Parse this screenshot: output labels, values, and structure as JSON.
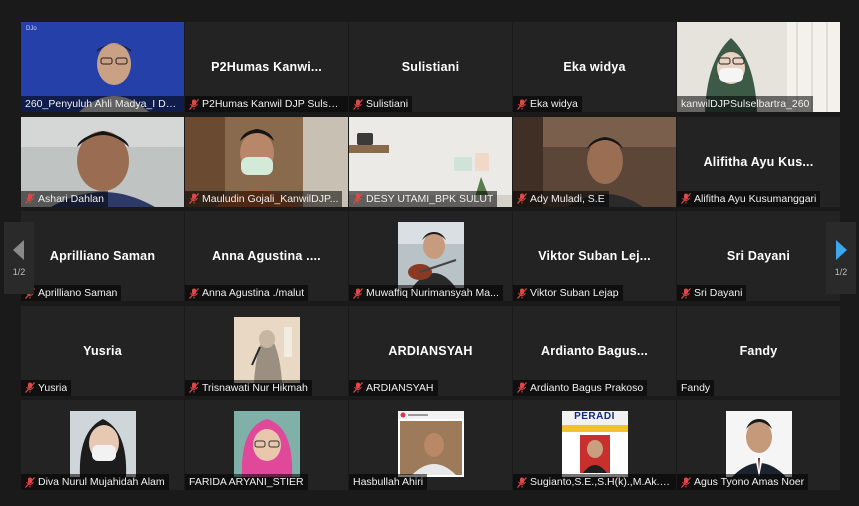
{
  "pager": {
    "left_page": "1/2",
    "right_page": "1/2"
  },
  "colors": {
    "active_speaker_border": "#c8d46a",
    "mic_off": "#e04848",
    "next_arrow": "#3ba7ef"
  },
  "tiles": [
    {
      "center": "",
      "label": "260_Penyuluh Ahli Madya_I De...",
      "muted": false,
      "video": "speaker-video",
      "watermark": "DJo"
    },
    {
      "center": "P2Humas  Kanwi...",
      "label": "P2Humas Kanwil DJP Sulsel...",
      "muted": true
    },
    {
      "center": "Sulistiani",
      "label": "Sulistiani",
      "muted": true
    },
    {
      "center": "Eka widya",
      "label": "Eka widya",
      "muted": true
    },
    {
      "center": "",
      "label": "kanwilDJPSulselbartra_260",
      "muted": false,
      "video": "hijab-mask-video"
    },
    {
      "center": "",
      "label": "Ashari Dahlan",
      "muted": true,
      "video": "man-video"
    },
    {
      "center": "",
      "label": "Mauludin Gojali_KanwilDJP...",
      "muted": true,
      "video": "mask-man-video"
    },
    {
      "center": "",
      "label": "DESY UTAMI_BPK SULUT",
      "muted": true,
      "video": "room-video"
    },
    {
      "center": "",
      "label": "Ady Muladi, S.E",
      "muted": true,
      "video": "man-video-2"
    },
    {
      "center": "Alifitha Ayu Kus...",
      "label": "Alifitha Ayu Kusumanggari",
      "muted": true
    },
    {
      "center": "Aprilliano Saman",
      "label": "Aprilliano Saman",
      "muted": true
    },
    {
      "center": "Anna Agustina ....",
      "label": "Anna Agustina ./malut",
      "muted": true
    },
    {
      "center": "",
      "label": "Muwaffiq Nurimansyah Ma...",
      "muted": true,
      "video": "thumb-guitar"
    },
    {
      "center": "Viktor Suban Lej...",
      "label": "Viktor Suban Lejap",
      "muted": true
    },
    {
      "center": "Sri Dayani",
      "label": "Sri Dayani",
      "muted": true
    },
    {
      "center": "Yusria",
      "label": "Yusria",
      "muted": true
    },
    {
      "center": "",
      "label": "Trisnawati Nur Hikmah",
      "muted": true,
      "video": "thumb-illustration"
    },
    {
      "center": "ARDIANSYAH",
      "label": "ARDIANSYAH",
      "muted": true
    },
    {
      "center": "Ardianto  Bagus...",
      "label": "Ardianto Bagus Prakoso",
      "muted": true
    },
    {
      "center": "Fandy",
      "label": "Fandy",
      "muted": false
    },
    {
      "center": "",
      "label": "Diva Nurul Mujahidah Alam",
      "muted": true,
      "video": "thumb-selfie"
    },
    {
      "center": "",
      "label": "FARIDA ARYANI_STIER",
      "muted": false,
      "video": "thumb-hijab"
    },
    {
      "center": "",
      "label": "Hasbullah Ahiri",
      "muted": false,
      "video": "thumb-post"
    },
    {
      "center": "",
      "label": "Sugianto,S.E.,S.H(k).,M.Ak.,B...",
      "muted": true,
      "video": "thumb-peradi",
      "logo_text": "PERADI"
    },
    {
      "center": "",
      "label": "Agus Tyono Amas Noer",
      "muted": true,
      "video": "thumb-suit"
    }
  ]
}
